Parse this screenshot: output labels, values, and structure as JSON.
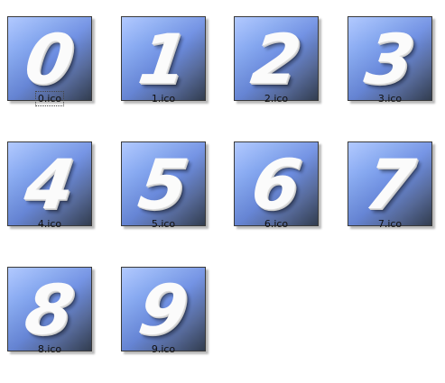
{
  "files": [
    {
      "digit": "0",
      "name": "0.ico",
      "selected": true
    },
    {
      "digit": "1",
      "name": "1.ico",
      "selected": false
    },
    {
      "digit": "2",
      "name": "2.ico",
      "selected": false
    },
    {
      "digit": "3",
      "name": "3.ico",
      "selected": false
    },
    {
      "digit": "4",
      "name": "4.ico",
      "selected": false
    },
    {
      "digit": "5",
      "name": "5.ico",
      "selected": false
    },
    {
      "digit": "6",
      "name": "6.ico",
      "selected": false
    },
    {
      "digit": "7",
      "name": "7.ico",
      "selected": false
    },
    {
      "digit": "8",
      "name": "8.ico",
      "selected": false
    },
    {
      "digit": "9",
      "name": "9.ico",
      "selected": false
    }
  ]
}
